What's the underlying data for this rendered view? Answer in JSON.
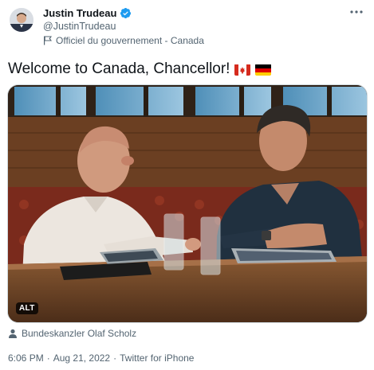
{
  "author": {
    "display_name": "Justin Trudeau",
    "handle": "@JustinTrudeau",
    "government_label": "Officiel du gouvernement - Canada",
    "avatar_icon": "avatar-photo",
    "verified_icon": "verified-badge-icon",
    "verified_color": "#1d9bf0"
  },
  "more_icon": "more-options-icon",
  "tweet": {
    "text": "Welcome to Canada, Chancellor!",
    "emojis": [
      "canada-flag-emoji",
      "germany-flag-emoji"
    ]
  },
  "media": {
    "alt_badge": "ALT",
    "description_icon": "photo"
  },
  "tagged": {
    "icon": "person-icon",
    "name": "Bundeskanzler Olaf Scholz"
  },
  "meta": {
    "time": "6:06 PM",
    "separator1": "·",
    "date": "Aug 21, 2022",
    "separator2": "·",
    "source": "Twitter for iPhone"
  },
  "colors": {
    "text_primary": "#0f1419",
    "text_secondary": "#536471",
    "border": "#cfd9de"
  }
}
